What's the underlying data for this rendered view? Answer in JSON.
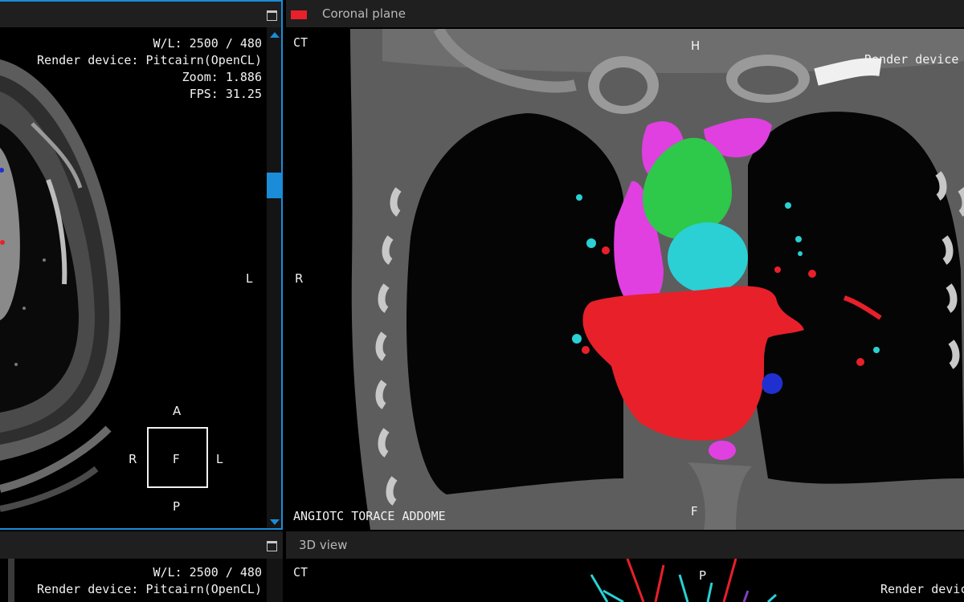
{
  "axial_view": {
    "window_level": "W/L: 2500 / 480",
    "render_device": "Render device: Pitcairn(OpenCL)",
    "zoom": "Zoom: 1.886",
    "fps": "FPS: 31.25",
    "side_label": "L",
    "orientation_cube": {
      "top": "A",
      "left": "R",
      "center": "F",
      "right": "L",
      "bottom": "P"
    },
    "scroll_position": 0.29
  },
  "coronal_view": {
    "title": "Coronal plane",
    "modality": "CT",
    "render_device": "Render device",
    "top_label": "H",
    "left_label": "R",
    "bottom_label": "F",
    "study": "ANGIOTC TORACE ADDOME",
    "color_swatch": "#e8202a"
  },
  "lower_left_view": {
    "window_level": "W/L: 2500 / 480",
    "render_device": "Render device: Pitcairn(OpenCL)"
  },
  "view_3d": {
    "title": "3D view",
    "modality": "CT",
    "top_label": "P",
    "render_device": "Render device"
  },
  "colors": {
    "accent_blue": "#1a8cd8",
    "segment_red": "#e8202a",
    "segment_green": "#2ec84a",
    "segment_cyan": "#2ad0d4",
    "segment_magenta": "#e040e0",
    "segment_blue": "#2030d0"
  },
  "icons": [
    "maximize-icon",
    "scroll-up-arrow-icon",
    "scroll-down-arrow-icon",
    "color-swatch-icon"
  ]
}
